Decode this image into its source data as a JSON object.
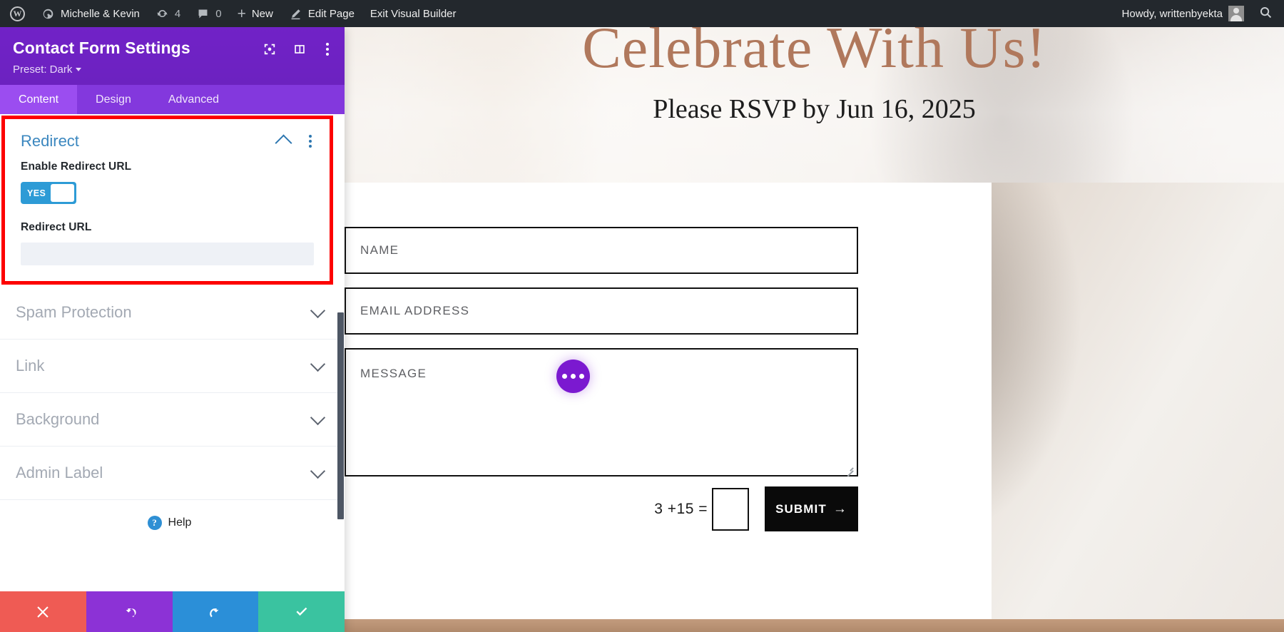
{
  "adminbar": {
    "logo_icon": "wordpress-logo-icon",
    "site_name": "Michelle & Kevin",
    "updates_icon": "updates-icon",
    "updates_count": "4",
    "comments_icon": "comments-icon",
    "comments_count": "0",
    "new_icon": "plus-icon",
    "new_label": "New",
    "edit_icon": "pencil-icon",
    "edit_label": "Edit Page",
    "exit_label": "Exit Visual Builder",
    "howdy": "Howdy, writtenbyekta",
    "avatar_icon": "avatar-icon",
    "search_icon": "search-icon"
  },
  "panel": {
    "title": "Contact Form Settings",
    "preset_label": "Preset: Dark",
    "head_icons": [
      "focus-target-icon",
      "layout-panel-icon",
      "more-options-icon"
    ],
    "tabs": [
      {
        "label": "Content",
        "active": true
      },
      {
        "label": "Design",
        "active": false
      },
      {
        "label": "Advanced",
        "active": false
      }
    ],
    "redirect": {
      "title": "Redirect",
      "collapse_icon": "chevron-up-icon",
      "options_icon": "more-options-icon",
      "enable_label": "Enable Redirect URL",
      "toggle_value": "YES",
      "url_label": "Redirect URL",
      "url_value": "",
      "url_placeholder": "",
      "highlight_color": "#fd0000"
    },
    "sections": [
      {
        "label": "Spam Protection",
        "chevron": "chevron-down-icon"
      },
      {
        "label": "Link",
        "chevron": "chevron-down-icon"
      },
      {
        "label": "Background",
        "chevron": "chevron-down-icon"
      },
      {
        "label": "Admin Label",
        "chevron": "chevron-down-icon"
      }
    ],
    "help_label": "Help",
    "help_icon": "question-mark-icon",
    "footer_buttons": [
      {
        "name": "cancel",
        "icon": "close-x-icon",
        "color": "#ef5b54"
      },
      {
        "name": "undo",
        "icon": "undo-icon",
        "color": "#8c32d6"
      },
      {
        "name": "redo",
        "icon": "redo-icon",
        "color": "#2b8fd8"
      },
      {
        "name": "save",
        "icon": "checkmark-icon",
        "color": "#3ac3a0"
      }
    ],
    "accent_purple": "#6d28c4",
    "tab_purple": "#9b4df0"
  },
  "preview": {
    "hero_heading": "Celebrate With Us!",
    "hero_subheading": "Please RSVP by Jun 16, 2025",
    "hero_heading_color": "#b0785c",
    "form": {
      "name_placeholder": "NAME",
      "email_placeholder": "EMAIL ADDRESS",
      "message_placeholder": "MESSAGE",
      "captcha_question": "3 +15 =",
      "captcha_value": "",
      "submit_label": "SUBMIT",
      "submit_arrow": "→"
    },
    "fab_icon": "more-dots-icon"
  }
}
